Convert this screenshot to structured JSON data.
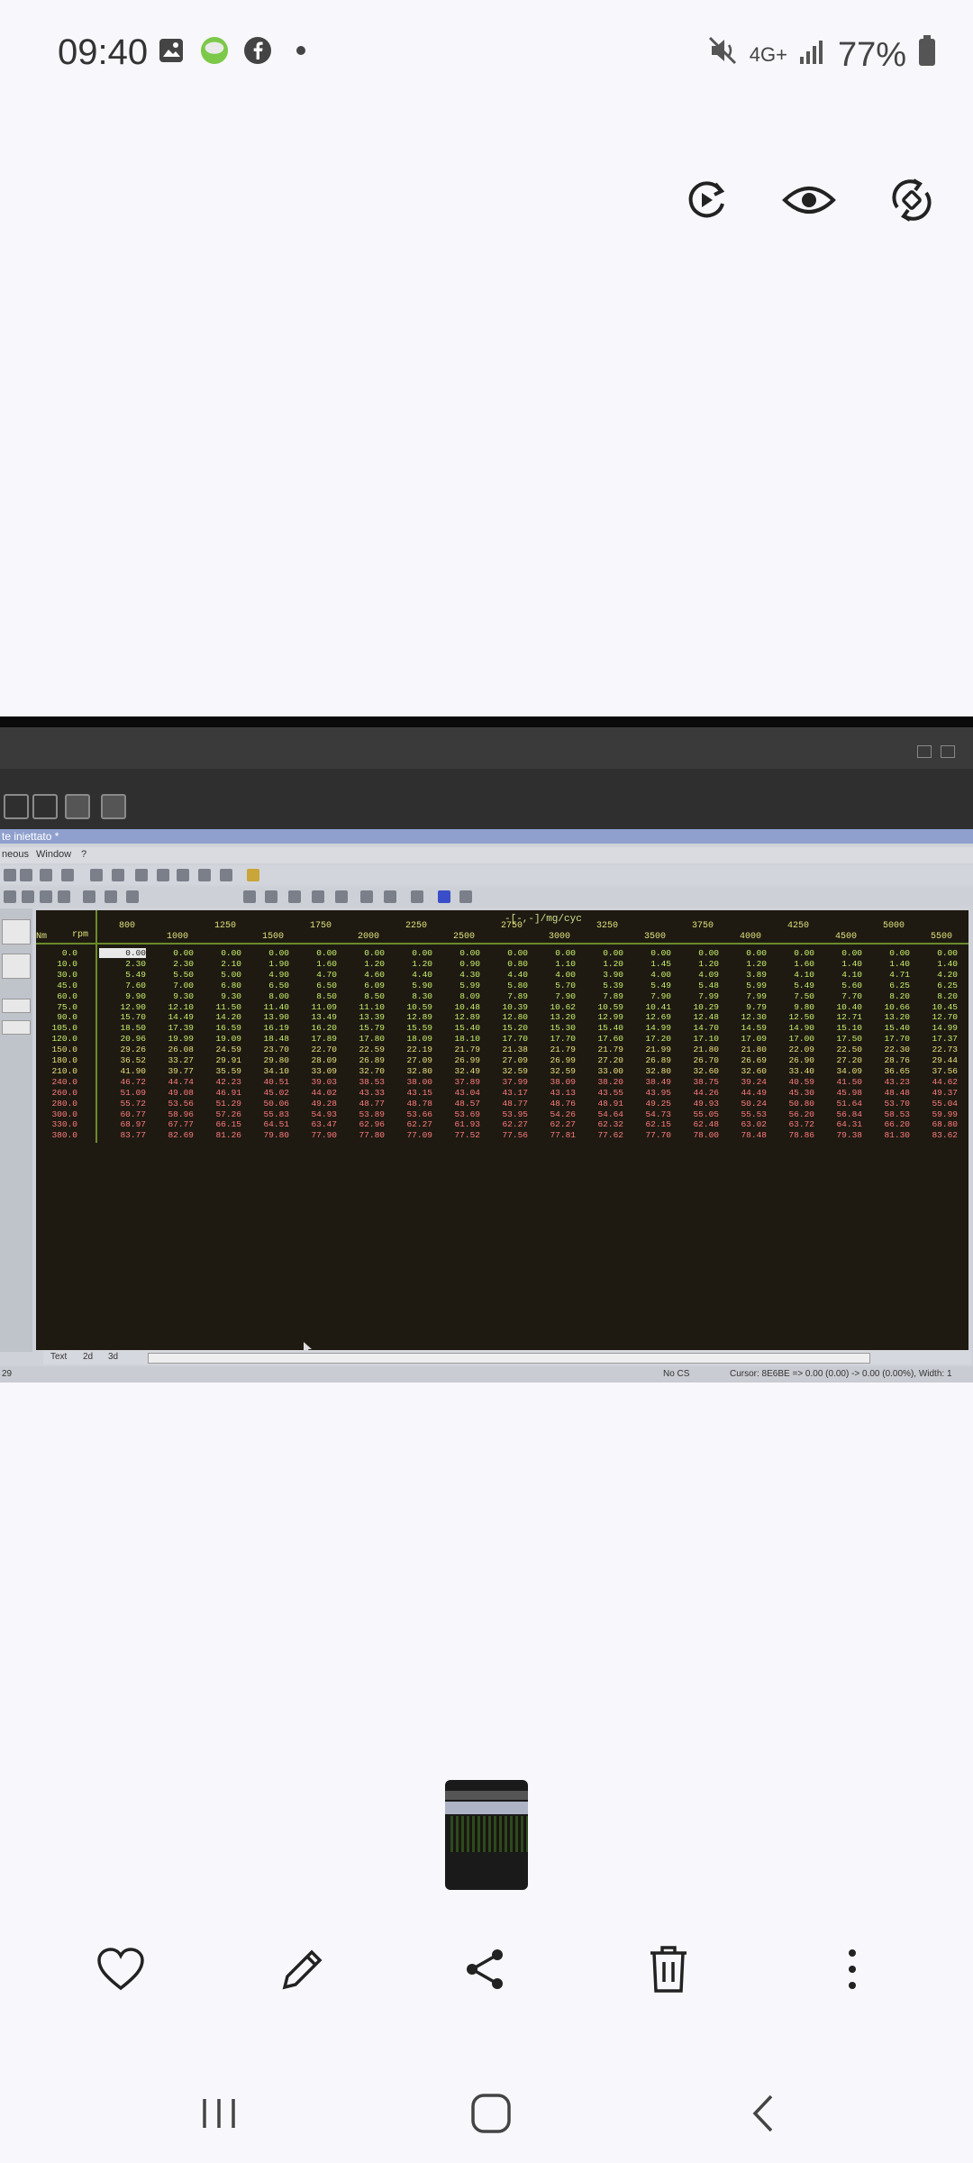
{
  "status_bar": {
    "time": "09:40",
    "battery": "77%",
    "network": "4G+",
    "left_icons": [
      "gallery-icon",
      "app-icon",
      "facebook-icon",
      "dot-icon"
    ],
    "right_icons": [
      "mute-icon",
      "network-icon",
      "signal-icon",
      "battery-icon"
    ]
  },
  "top_actions": [
    "motion-photo-icon",
    "eye-icon",
    "rotate-icon"
  ],
  "photo": {
    "app_title": "te iniettato *",
    "menu": [
      "neous",
      "Window",
      "?"
    ],
    "table_title": "-[-,-]/mg/cyc",
    "rpm_label": "rpm",
    "row_axis_label": "Nm",
    "rpm_top": [
      "800",
      "1250",
      "1750",
      "2250",
      "2750",
      "3250",
      "3750",
      "4250",
      "5000"
    ],
    "rpm_bottom": [
      "1000",
      "1500",
      "2000",
      "2500",
      "3000",
      "3500",
      "4000",
      "4500",
      "5500"
    ],
    "rows": [
      {
        "label": "0.0",
        "values": [
          "0.00",
          "0.00",
          "0.00",
          "0.00",
          "0.00",
          "0.00",
          "0.00",
          "0.00",
          "0.00",
          "0.00",
          "0.00",
          "0.00",
          "0.00",
          "0.00",
          "0.00",
          "0.00",
          "0.00",
          "0.00"
        ]
      },
      {
        "label": "10.0",
        "values": [
          "2.30",
          "2.30",
          "2.10",
          "1.90",
          "1.60",
          "1.20",
          "1.20",
          "0.90",
          "0.80",
          "1.10",
          "1.20",
          "1.45",
          "1.20",
          "1.20",
          "1.60",
          "1.40",
          "1.40",
          "1.40"
        ]
      },
      {
        "label": "30.0",
        "values": [
          "5.49",
          "5.50",
          "5.00",
          "4.90",
          "4.70",
          "4.60",
          "4.40",
          "4.30",
          "4.40",
          "4.00",
          "3.90",
          "4.00",
          "4.09",
          "3.89",
          "4.10",
          "4.10",
          "4.71",
          "4.20"
        ]
      },
      {
        "label": "45.0",
        "values": [
          "7.60",
          "7.00",
          "6.80",
          "6.50",
          "6.50",
          "6.09",
          "5.90",
          "5.99",
          "5.80",
          "5.70",
          "5.39",
          "5.49",
          "5.48",
          "5.99",
          "5.49",
          "5.60",
          "6.25",
          "6.25"
        ]
      },
      {
        "label": "60.0",
        "values": [
          "9.90",
          "9.30",
          "9.30",
          "8.00",
          "8.50",
          "8.50",
          "8.30",
          "8.09",
          "7.89",
          "7.90",
          "7.89",
          "7.90",
          "7.99",
          "7.99",
          "7.50",
          "7.70",
          "8.20",
          "8.20"
        ]
      },
      {
        "label": "75.0",
        "values": [
          "12.90",
          "12.10",
          "11.50",
          "11.40",
          "11.09",
          "11.10",
          "10.59",
          "10.48",
          "10.39",
          "10.62",
          "10.59",
          "10.41",
          "10.29",
          "9.79",
          "9.80",
          "10.40",
          "10.66",
          "10.45"
        ]
      },
      {
        "label": "90.0",
        "values": [
          "15.70",
          "14.49",
          "14.20",
          "13.90",
          "13.49",
          "13.39",
          "12.89",
          "12.89",
          "12.80",
          "13.20",
          "12.99",
          "12.69",
          "12.48",
          "12.30",
          "12.50",
          "12.71",
          "13.20",
          "12.70"
        ]
      },
      {
        "label": "105.0",
        "values": [
          "18.50",
          "17.39",
          "16.59",
          "16.19",
          "16.20",
          "15.79",
          "15.59",
          "15.40",
          "15.20",
          "15.30",
          "15.40",
          "14.99",
          "14.70",
          "14.59",
          "14.90",
          "15.10",
          "15.40",
          "14.99"
        ]
      },
      {
        "label": "120.0",
        "values": [
          "20.96",
          "19.99",
          "19.09",
          "18.48",
          "17.89",
          "17.80",
          "18.09",
          "18.10",
          "17.70",
          "17.70",
          "17.60",
          "17.20",
          "17.10",
          "17.09",
          "17.00",
          "17.50",
          "17.70",
          "17.37"
        ]
      },
      {
        "label": "150.0",
        "values": [
          "29.26",
          "26.08",
          "24.59",
          "23.70",
          "22.70",
          "22.59",
          "22.19",
          "21.79",
          "21.38",
          "21.79",
          "21.79",
          "21.99",
          "21.80",
          "21.80",
          "22.09",
          "22.50",
          "22.30",
          "22.73"
        ]
      },
      {
        "label": "180.0",
        "values": [
          "36.52",
          "33.27",
          "29.91",
          "29.80",
          "28.09",
          "26.89",
          "27.09",
          "26.99",
          "27.09",
          "26.99",
          "27.20",
          "26.89",
          "26.70",
          "26.69",
          "26.90",
          "27.20",
          "28.76",
          "29.44"
        ]
      },
      {
        "label": "210.0",
        "values": [
          "41.90",
          "39.77",
          "35.59",
          "34.10",
          "33.09",
          "32.70",
          "32.80",
          "32.49",
          "32.59",
          "32.59",
          "33.00",
          "32.80",
          "32.60",
          "32.60",
          "33.40",
          "34.09",
          "36.65",
          "37.56"
        ]
      },
      {
        "label": "240.0",
        "values": [
          "46.72",
          "44.74",
          "42.23",
          "40.51",
          "39.03",
          "38.53",
          "38.00",
          "37.89",
          "37.99",
          "38.09",
          "38.20",
          "38.49",
          "38.75",
          "39.24",
          "40.59",
          "41.50",
          "43.23",
          "44.62"
        ]
      },
      {
        "label": "260.0",
        "values": [
          "51.09",
          "49.08",
          "46.91",
          "45.02",
          "44.02",
          "43.33",
          "43.15",
          "43.04",
          "43.17",
          "43.13",
          "43.55",
          "43.95",
          "44.26",
          "44.49",
          "45.30",
          "45.98",
          "48.48",
          "49.37"
        ]
      },
      {
        "label": "280.0",
        "values": [
          "55.72",
          "53.56",
          "51.29",
          "50.06",
          "49.28",
          "48.77",
          "48.78",
          "48.57",
          "48.77",
          "48.76",
          "48.91",
          "49.25",
          "49.93",
          "50.24",
          "50.80",
          "51.64",
          "53.70",
          "55.04"
        ]
      },
      {
        "label": "300.0",
        "values": [
          "60.77",
          "58.96",
          "57.26",
          "55.83",
          "54.93",
          "53.89",
          "53.66",
          "53.69",
          "53.95",
          "54.26",
          "54.64",
          "54.73",
          "55.05",
          "55.53",
          "56.20",
          "56.84",
          "58.53",
          "59.99"
        ]
      },
      {
        "label": "330.0",
        "values": [
          "68.97",
          "67.77",
          "66.15",
          "64.51",
          "63.47",
          "62.96",
          "62.27",
          "61.93",
          "62.27",
          "62.27",
          "62.32",
          "62.15",
          "62.48",
          "63.02",
          "63.72",
          "64.31",
          "66.20",
          "68.80"
        ]
      },
      {
        "label": "380.0",
        "values": [
          "83.77",
          "82.69",
          "81.26",
          "79.80",
          "77.90",
          "77.80",
          "77.09",
          "77.52",
          "77.56",
          "77.81",
          "77.62",
          "77.70",
          "78.00",
          "78.48",
          "78.86",
          "79.38",
          "81.30",
          "83.62"
        ]
      }
    ],
    "bottom_tabs": [
      "Text",
      "2d",
      "3d"
    ],
    "status_cs": "No CS",
    "status_cursor": "Cursor: 8E6BE => 0.00 (0.00) -> 0.00 (0.00%), Width: 1",
    "status_left": "29",
    "colors": {
      "grid_bg": "#1e1a12",
      "value_green": "#c8f06a",
      "value_yellow": "#e8e07a",
      "value_red": "#ff7b7b"
    }
  },
  "bottom_actions": [
    "heart-icon",
    "edit-icon",
    "share-icon",
    "delete-icon",
    "more-icon"
  ],
  "nav_bar": [
    "recent-apps-icon",
    "home-icon",
    "back-icon"
  ]
}
